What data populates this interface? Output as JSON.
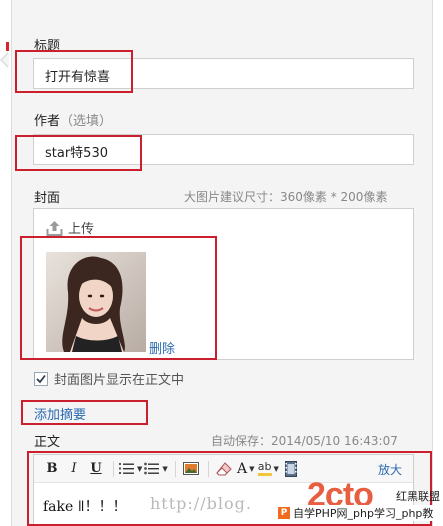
{
  "title_field": {
    "label": "标题",
    "value": "打开有惊喜"
  },
  "author_field": {
    "label": "作者",
    "hint": "（选填）",
    "value": "star特530"
  },
  "cover": {
    "label": "封面",
    "size_note": "大图片建议尺寸：360像素 * 200像素",
    "upload_label": "上传",
    "delete_label": "删除",
    "show_in_body_label": "封面图片显示在正文中",
    "show_in_body_checked": true
  },
  "add_summary_label": "添加摘要",
  "body_field": {
    "label": "正文",
    "autosave": "自动保存：2014/05/10 16:43:07",
    "zoom_label": "放大",
    "text": "fake ǁ！！！",
    "toolbar": {
      "bold": "B",
      "italic": "I",
      "underline": "U",
      "font_color": "A",
      "highlight": "ab"
    }
  },
  "watermark": {
    "url": "http://blog.",
    "logo": "2cto",
    "site_cn": "红黑联盟",
    "bar_text": "自学PHP网_php学习_php教"
  },
  "colors": {
    "link": "#2a6ab1",
    "annotation_red": "#cc1f2d",
    "panel_bg": "#f4f4f4"
  },
  "icons": [
    "upload-icon",
    "checkbox-check-icon",
    "ordered-list-icon",
    "unordered-list-icon",
    "image-icon",
    "eraser-icon",
    "highlight-icon",
    "video-icon"
  ]
}
